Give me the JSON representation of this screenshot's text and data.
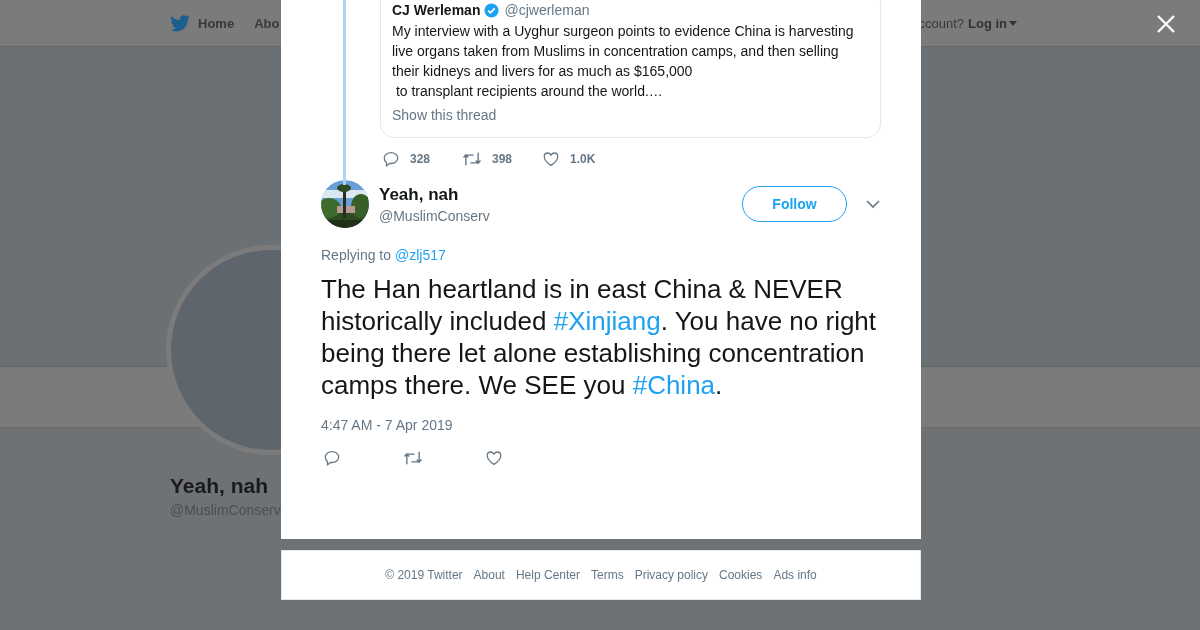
{
  "background_page": {
    "nav_items": [
      {
        "label": "Home",
        "icon": true
      },
      {
        "label": "Abo",
        "icon": false
      }
    ],
    "login_prompt": "ccount?",
    "login_link": "Log in",
    "profile": {
      "name": "Yeah, nah",
      "handle": "@MuslimConserv"
    }
  },
  "quoted_tweet": {
    "author": "CJ Werleman",
    "verified": true,
    "handle": "@cjwerleman",
    "text": "My interview with a Uyghur surgeon points to evidence China is harvesting live organs taken from Muslims in concentration camps, and then selling their kidneys and livers for as much as $165,000\n to transplant recipients around the world.…",
    "show_thread": "Show this thread",
    "replies": "328",
    "retweets": "398",
    "likes": "1.0K"
  },
  "tweet": {
    "author": "Yeah, nah",
    "handle": "@MuslimConserv",
    "follow": "Follow",
    "replying_label": "Replying to",
    "replying_to": "@zlj517",
    "segments": [
      {
        "kind": "plain",
        "text": "The Han heartland is in east China & NEVER historically included "
      },
      {
        "kind": "hashtag",
        "text": "#Xinjiang"
      },
      {
        "kind": "plain",
        "text": ". You have no right being there let alone establishing concentration camps there. We SEE you "
      },
      {
        "kind": "hashtag",
        "text": "#China"
      },
      {
        "kind": "plain",
        "text": "."
      }
    ],
    "timestamp": "4:47 AM - 7 Apr 2019"
  },
  "footer": [
    "© 2019 Twitter",
    "About",
    "Help Center",
    "Terms",
    "Privacy policy",
    "Cookies",
    "Ads info"
  ]
}
